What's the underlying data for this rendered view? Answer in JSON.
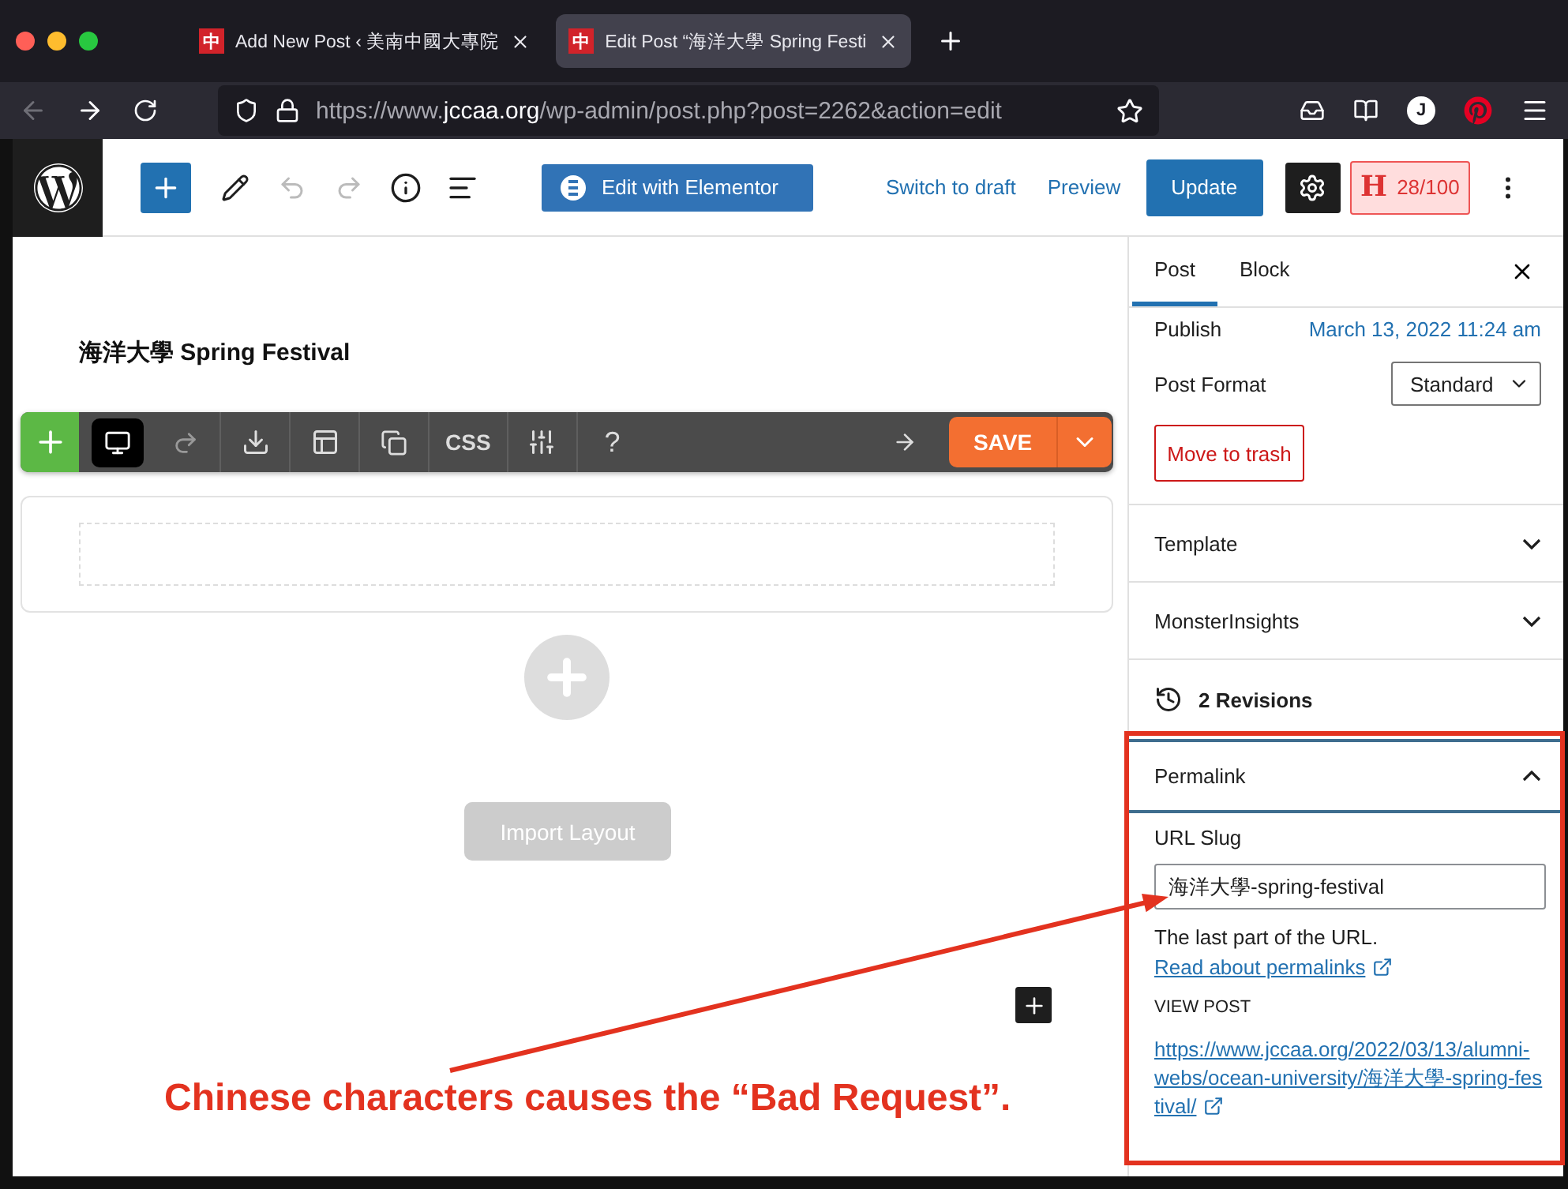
{
  "browser": {
    "tabs": [
      {
        "favicon_text": "中",
        "title": "Add New Post ‹ 美南中國大專院",
        "selected": false
      },
      {
        "favicon_text": "中",
        "title": "Edit Post “海洋大學 Spring Festi",
        "selected": true
      }
    ],
    "url": {
      "prefix": "https://www.",
      "domain": "jccaa.org",
      "path": "/wp-admin/post.php?post=2262&action=edit"
    },
    "account_initial": "J"
  },
  "wp_toolbar": {
    "elementor_button": "Edit with Elementor",
    "switch_to_draft": "Switch to draft",
    "preview": "Preview",
    "update": "Update",
    "seo_letter": "H",
    "seo_score": "28/100"
  },
  "editor": {
    "post_title": "海洋大學 Spring Festival",
    "builder_toolbar": {
      "css": "CSS",
      "help": "?",
      "save": "SAVE"
    },
    "import_layout": "Import Layout"
  },
  "sidebar": {
    "tabs": [
      {
        "label": "Post",
        "selected": true
      },
      {
        "label": "Block",
        "selected": false
      }
    ],
    "publish_label": "Publish",
    "publish_date": "March 13, 2022 11:24 am",
    "post_format_label": "Post Format",
    "post_format_value": "Standard",
    "trash_button": "Move to trash",
    "panels": [
      {
        "title": "Template",
        "expanded": false
      },
      {
        "title": "MonsterInsights",
        "expanded": false
      }
    ],
    "revisions": "2 Revisions",
    "permalink": {
      "title": "Permalink",
      "expanded": true,
      "slug_label": "URL Slug",
      "slug_value": "海洋大學-spring-festival",
      "help_text": "The last part of the URL.",
      "help_link": "Read about permalinks",
      "view_post_label": "VIEW POST",
      "view_post_url": "https://www.jccaa.org/2022/03/13/alumni-webs/ocean-university/海洋大學-spring-festival/"
    }
  },
  "annotation": {
    "text": "Chinese characters causes the “Bad Request”."
  }
}
